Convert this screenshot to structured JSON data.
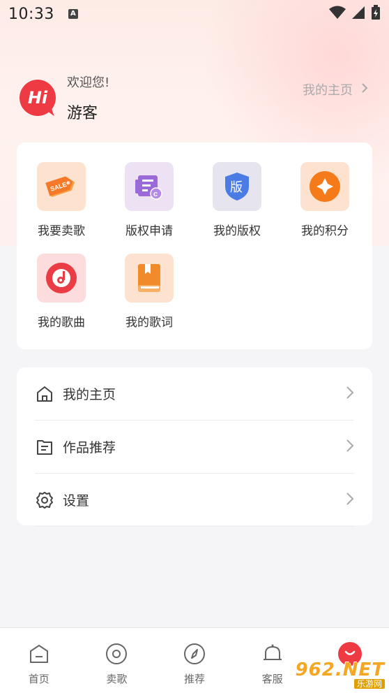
{
  "status_bar": {
    "time": "10:33",
    "notif_letter": "A"
  },
  "profile": {
    "welcome": "欢迎您!",
    "username": "游客",
    "avatar_text": "Hi",
    "home_link": "我的主页"
  },
  "features": [
    {
      "label": "我要卖歌",
      "icon": "sale-tag-icon",
      "bg": "#fde3cf",
      "color": "#f47a2a"
    },
    {
      "label": "版权申请",
      "icon": "copyright-apply-icon",
      "bg": "#ece2f4",
      "color": "#9a6ad8"
    },
    {
      "label": "我的版权",
      "icon": "copyright-shield-icon",
      "bg": "#e6e4ee",
      "color": "#4b7be4",
      "glyph": "版"
    },
    {
      "label": "我的积分",
      "icon": "points-diamond-icon",
      "bg": "#fde3cf",
      "color": "#f47a1a"
    },
    {
      "label": "我的歌曲",
      "icon": "music-disc-icon",
      "bg": "#fcdcdc",
      "color": "#ea3c44"
    },
    {
      "label": "我的歌词",
      "icon": "lyrics-book-icon",
      "bg": "#fde3cf",
      "color": "#f08a2a"
    }
  ],
  "menu": [
    {
      "label": "我的主页",
      "icon": "home-icon"
    },
    {
      "label": "作品推荐",
      "icon": "document-list-icon"
    },
    {
      "label": "设置",
      "icon": "gear-icon"
    }
  ],
  "bottom_nav": [
    {
      "label": "首页",
      "icon": "home-tab-icon"
    },
    {
      "label": "卖歌",
      "icon": "disc-tab-icon"
    },
    {
      "label": "推荐",
      "icon": "compass-tab-icon"
    },
    {
      "label": "客服",
      "icon": "bell-tab-icon"
    },
    {
      "label": "",
      "icon": "me-tab-icon"
    }
  ],
  "watermark": {
    "top": "962.NET",
    "bottom": "乐游网"
  },
  "colors": {
    "accent": "#ee3a42",
    "text": "#333333",
    "muted": "#aaaaaa"
  }
}
